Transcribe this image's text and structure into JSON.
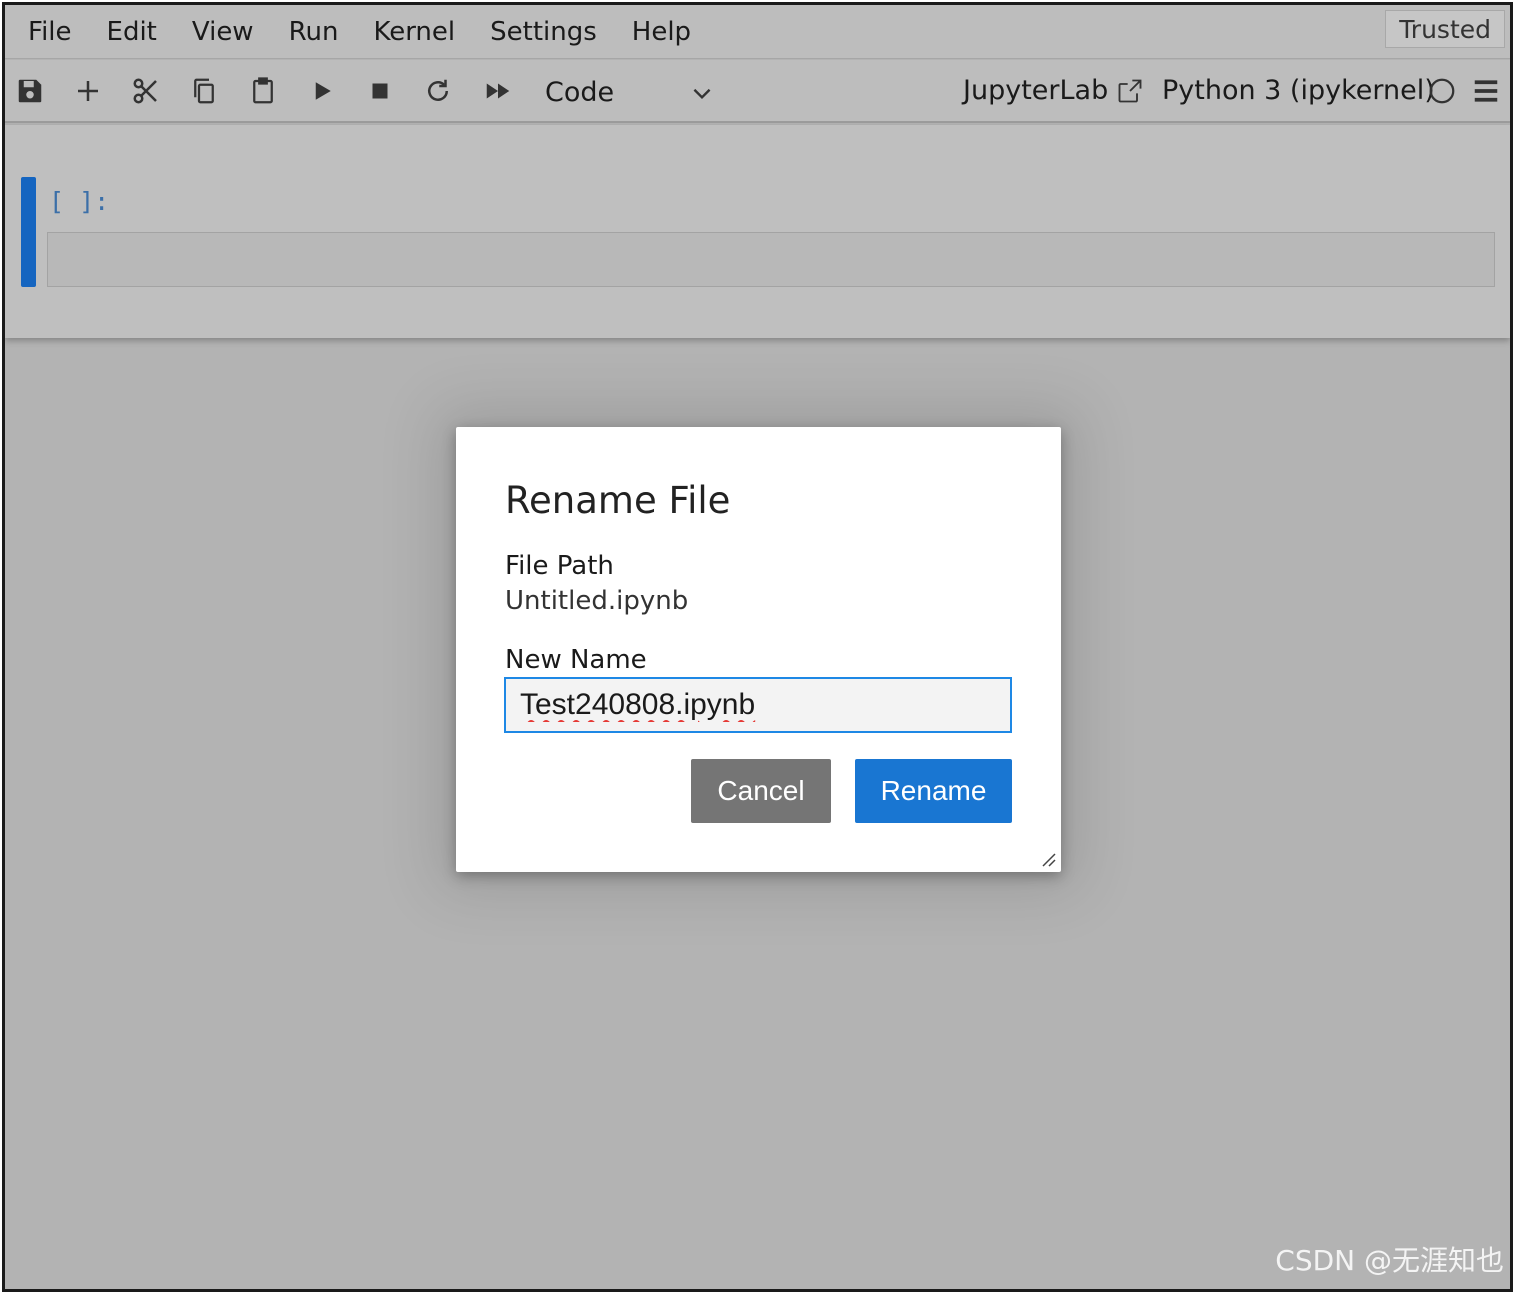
{
  "menubar": {
    "items": [
      {
        "label": "File"
      },
      {
        "label": "Edit"
      },
      {
        "label": "View"
      },
      {
        "label": "Run"
      },
      {
        "label": "Kernel"
      },
      {
        "label": "Settings"
      },
      {
        "label": "Help"
      }
    ],
    "trusted_label": "Trusted"
  },
  "toolbar": {
    "icons": [
      "save-icon",
      "plus-icon",
      "cut-icon",
      "copy-icon",
      "paste-icon",
      "run-icon",
      "stop-icon",
      "restart-icon",
      "fast-forward-icon"
    ],
    "cell_type": "Code",
    "jupyterlab_label": "JupyterLab",
    "kernel_name": "Python 3 (ipykernel)"
  },
  "notebook": {
    "cell_prompt": "[ ]:",
    "cell_bar_color": "#1565c0"
  },
  "dialog": {
    "title": "Rename File",
    "file_path_label": "File Path",
    "file_path_value": "Untitled.ipynb",
    "new_name_label": "New Name",
    "new_name_value": "Test240808.ipynb",
    "cancel_label": "Cancel",
    "rename_label": "Rename",
    "accent_color": "#1976d2"
  },
  "watermark": "CSDN @无涯知也"
}
